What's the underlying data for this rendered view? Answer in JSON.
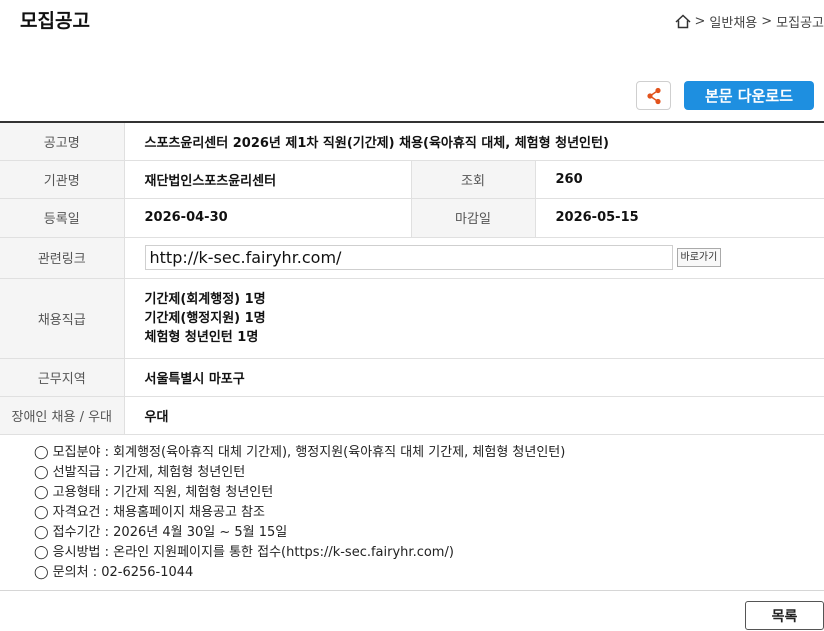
{
  "header": {
    "title": "모집공고",
    "breadcrumb": [
      ">",
      "일반채용",
      ">",
      "모집공고"
    ]
  },
  "actions": {
    "download_label": "본문 다운로드",
    "list_label": "목록"
  },
  "table": {
    "labels": {
      "title": "공고명",
      "org": "기관명",
      "views": "조회",
      "registered": "등록일",
      "deadline": "마감일",
      "link": "관련링크",
      "positions": "채용직급",
      "region": "근무지역",
      "disabled": "장애인 채용 / 우대"
    },
    "values": {
      "title": "스포츠윤리센터 2026년 제1차 직원(기간제) 채용(육아휴직 대체, 체험형 청년인턴)",
      "org": "재단법인스포츠윤리센터",
      "views": "260",
      "registered": "2026-04-30",
      "deadline": "2026-05-15",
      "link": "http://k-sec.fairyhr.com/",
      "link_button": "바로가기",
      "positions": [
        "기간제(회계행정) 1명",
        "기간제(행정지원) 1명",
        "체험형 청년인턴 1명"
      ],
      "region": "서울특별시 마포구",
      "disabled": "우대"
    }
  },
  "details": [
    "◯ 모집분야 : 회계행정(육아휴직 대체 기간제), 행정지원(육아휴직 대체 기간제, 체험형 청년인턴)",
    "◯ 선발직급 : 기간제, 체험형 청년인턴",
    "◯ 고용형태 : 기간제 직원, 체험형 청년인턴",
    "◯ 자격요건 : 채용홈페이지 채용공고 참조",
    "◯ 접수기간 : 2026년 4월 30일 ~ 5월 15일",
    "◯ 응시방법 : 온라인 지원페이지를 통한 접수(https://k-sec.fairyhr.com/)",
    "◯ 문의처 : 02-6256-1044"
  ]
}
